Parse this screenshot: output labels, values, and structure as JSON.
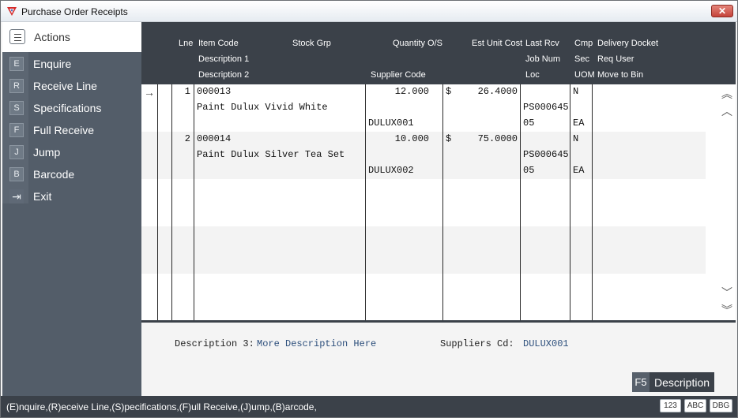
{
  "window": {
    "title": "Purchase Order Receipts",
    "close_label": "✕"
  },
  "sidebar": {
    "header": "Actions",
    "items": [
      {
        "key": "E",
        "label": "Enquire"
      },
      {
        "key": "R",
        "label": "Receive Line"
      },
      {
        "key": "S",
        "label": "Specifications"
      },
      {
        "key": "F",
        "label": "Full Receive"
      },
      {
        "key": "J",
        "label": "Jump"
      },
      {
        "key": "B",
        "label": "Barcode"
      },
      {
        "key": "exit-icon",
        "label": "Exit"
      }
    ]
  },
  "grid": {
    "headers": {
      "lne": "Lne",
      "item_code": "Item Code",
      "stock_grp": "Stock Grp",
      "qty_os": "Quantity O/S",
      "est_unit_cost": "Est Unit Cost",
      "last_rcv": "Last Rcv",
      "cmp": "Cmp",
      "delivery_docket": "Delivery Docket",
      "description1": "Description 1",
      "job_num": "Job Num",
      "sec": "Sec",
      "req_user": "Req User",
      "description2": "Description 2",
      "supplier_code": "Supplier Code",
      "loc": "Loc",
      "uom": "UOM",
      "move_to_bin": "Move to Bin"
    },
    "rows": [
      {
        "lne": "1",
        "item_code": "000013",
        "qty": "12.000",
        "currency": "$",
        "cost": "26.4000",
        "cmp": "N",
        "description1": "Paint Dulux Vivid White",
        "job_num": "PS000645",
        "supplier_code": "DULUX001",
        "loc": "05",
        "uom": "EA"
      },
      {
        "lne": "2",
        "item_code": "000014",
        "qty": "10.000",
        "currency": "$",
        "cost": "75.0000",
        "cmp": "N",
        "description1": "Paint Dulux Silver Tea Set",
        "job_num": "PS000645",
        "supplier_code": "DULUX002",
        "loc": "05",
        "uom": "EA"
      }
    ]
  },
  "footer": {
    "description3_label": "Description 3:",
    "description3_value": "More Description Here",
    "suppliers_cd_label": "Suppliers Cd:",
    "suppliers_cd_value": "DULUX001",
    "f5_key": "F5",
    "f5_label": "Description"
  },
  "statusbar": {
    "message": "(E)nquire,(R)eceive Line,(S)pecifications,(F)ull Receive,(J)ump,(B)arcode,",
    "indicators": [
      "123",
      "ABC",
      "DBG"
    ]
  }
}
